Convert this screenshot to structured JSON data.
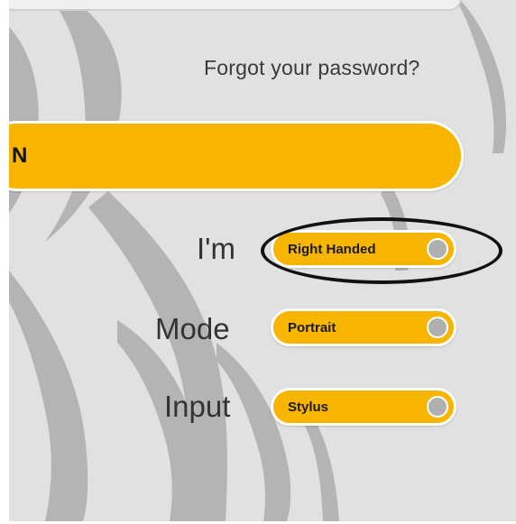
{
  "forgot_password": {
    "label": "Forgot your password?"
  },
  "signin_button": {
    "label_fragment": "N"
  },
  "settings": {
    "handedness": {
      "label": "I'm",
      "value": "Right Handed"
    },
    "mode": {
      "label": "Mode",
      "value": "Portrait"
    },
    "input": {
      "label": "Input",
      "value": "Stylus"
    }
  },
  "colors": {
    "accent": "#f7b500",
    "background": "#e1e1e1",
    "decoration": "#b4b4b4",
    "knob": "#b0b0b0",
    "annotation": "#111111"
  },
  "icons": {
    "background": "leaf-swirl-decoration",
    "toggle_knob": "toggle-knob"
  }
}
